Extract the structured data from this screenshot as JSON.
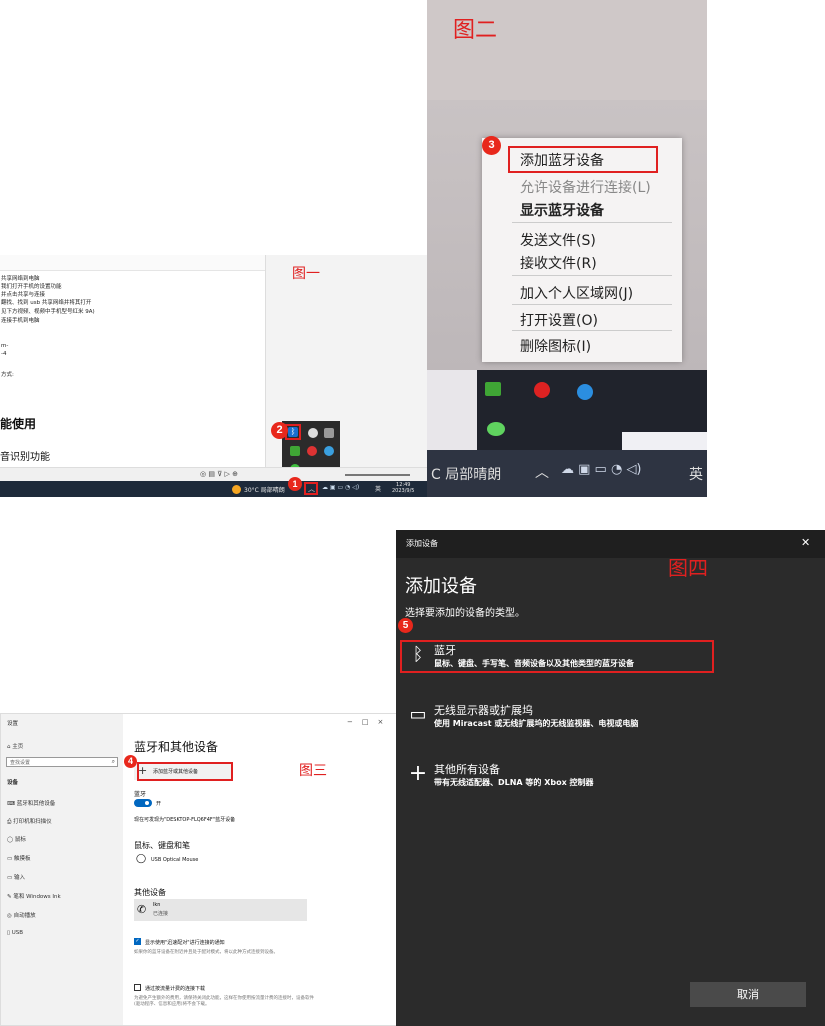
{
  "fig1": {
    "label": "图一",
    "doc_lines": [
      "共享网络到电脑",
      "我们打开手机的设置功能",
      "并点击共享与连接",
      "翻找、找到 usb 共享网络并将其打开",
      "见下方视频、视频中手机型号红米 9A)",
      "连接手机到电脑",
      "m-",
      "-4",
      "方式:"
    ],
    "heading_big": "能使用",
    "heading_mid": "音识别功能",
    "weather": "30°C 局部晴朗",
    "ime": "英",
    "time": "12:49",
    "date": "2023/9/5",
    "badge1": "1",
    "badge2": "2"
  },
  "fig2": {
    "label": "图二",
    "badge": "3",
    "menu": [
      "添加蓝牙设备",
      "允许设备进行连接(L)",
      "显示蓝牙设备",
      "发送文件(S)",
      "接收文件(R)",
      "加入个人区域网(J)",
      "打开设置(O)",
      "删除图标(I)"
    ],
    "taskbar_weather": "C 局部晴朗",
    "taskbar_ime": "英"
  },
  "fig3": {
    "label": "图三",
    "badge": "4",
    "window_title": "设置",
    "window_controls": [
      "−",
      "□",
      "×"
    ],
    "sidebar": {
      "home": "主页",
      "search_placeholder": "查找设置",
      "section": "设备",
      "items": [
        "蓝牙和其他设备",
        "打印机和扫描仪",
        "鼠标",
        "触摸板",
        "输入",
        "笔和 Windows Ink",
        "自动播放",
        "USB"
      ]
    },
    "main": {
      "title": "蓝牙和其他设备",
      "add_button": "添加蓝牙或其他设备",
      "bluetooth_label": "蓝牙",
      "toggle_state": "开",
      "discoverable": "现在可发现为\"DESKTOP-FLQ6F4F\"蓝牙设备",
      "mouse_section": "鼠标、键盘和笔",
      "mouse_device": "USB Optical Mouse",
      "other_section": "其他设备",
      "other_device_name": "lkn",
      "other_device_status": "已连接",
      "check1_label": "显示使用\"迅速配对\"进行连接的通知",
      "check1_desc": "如果你的蓝牙设备在附近并且处于配对模式，将以此种方式连接到设备。",
      "check2_label": "通过按流量计费的连接下载",
      "check2_desc": "为避免产生额外的费用，请保持关闭此功能，这样在你使用按流量计费的连接时，设备软件(驱动程序、信息和应用)将不会下载。"
    }
  },
  "fig4": {
    "label": "图四",
    "badge": "5",
    "window_title": "添加设备",
    "close": "✕",
    "heading": "添加设备",
    "subheading": "选择要添加的设备的类型。",
    "options": [
      {
        "title": "蓝牙",
        "desc": "鼠标、键盘、手写笔、音频设备以及其他类型的蓝牙设备"
      },
      {
        "title": "无线显示器或扩展坞",
        "desc": "使用 Miracast 或无线扩展坞的无线监视器、电视或电脑"
      },
      {
        "title": "其他所有设备",
        "desc": "带有无线适配器、DLNA 等的 Xbox 控制器"
      }
    ],
    "cancel": "取消"
  },
  "colors": {
    "highlight": "#e02020",
    "toggle_blue": "#0067c0",
    "dialog_bg": "#2b2b2b"
  }
}
